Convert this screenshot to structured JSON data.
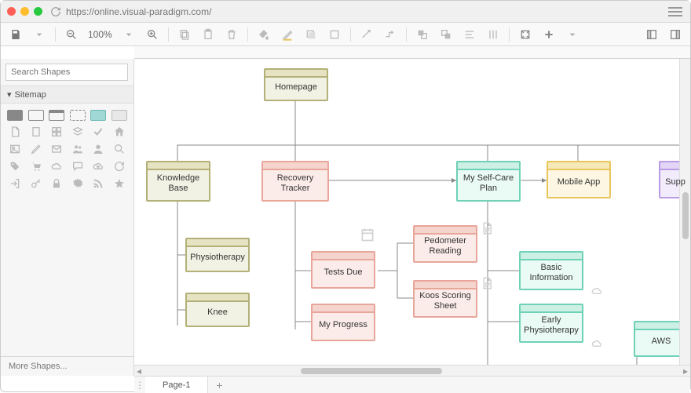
{
  "url": "https://online.visual-paradigm.com/",
  "zoom_label": "100%",
  "search": {
    "placeholder": "Search Shapes"
  },
  "palette_header": "Sitemap",
  "more_shapes": "More Shapes...",
  "page_tab": "Page-1",
  "nodes": {
    "homepage": {
      "label": "Homepage"
    },
    "kb": {
      "label": "Knowledge Base"
    },
    "recovery": {
      "label": "Recovery Tracker"
    },
    "selfcare": {
      "label": "My Self-Care Plan"
    },
    "mobile": {
      "label": "Mobile App"
    },
    "support": {
      "label": "Supp"
    },
    "physio": {
      "label": "Physiotherapy"
    },
    "knee": {
      "label": "Knee"
    },
    "testsdue": {
      "label": "Tests Due"
    },
    "progress": {
      "label": "My Progress"
    },
    "pedometer": {
      "label": "Pedometer Reading"
    },
    "koos": {
      "label": "Koos Scoring Sheet"
    },
    "basic": {
      "label": "Basic Information"
    },
    "earlyphysio": {
      "label": "Early Physiotherapy"
    },
    "aws": {
      "label": "AWS"
    }
  },
  "colors": {
    "olive": "#b3b078",
    "salmon": "#e8a69b",
    "teal": "#6fd1b6",
    "gold": "#e8c65c",
    "purple": "#b89ce6"
  },
  "icons": {
    "search": "search-icon",
    "menu": "menu-icon",
    "save": "save-icon",
    "zoom_out": "zoom-out-icon",
    "zoom_in": "zoom-in-icon",
    "cloud": "cloud-icon",
    "document": "document-icon",
    "calendar": "calendar-icon"
  }
}
